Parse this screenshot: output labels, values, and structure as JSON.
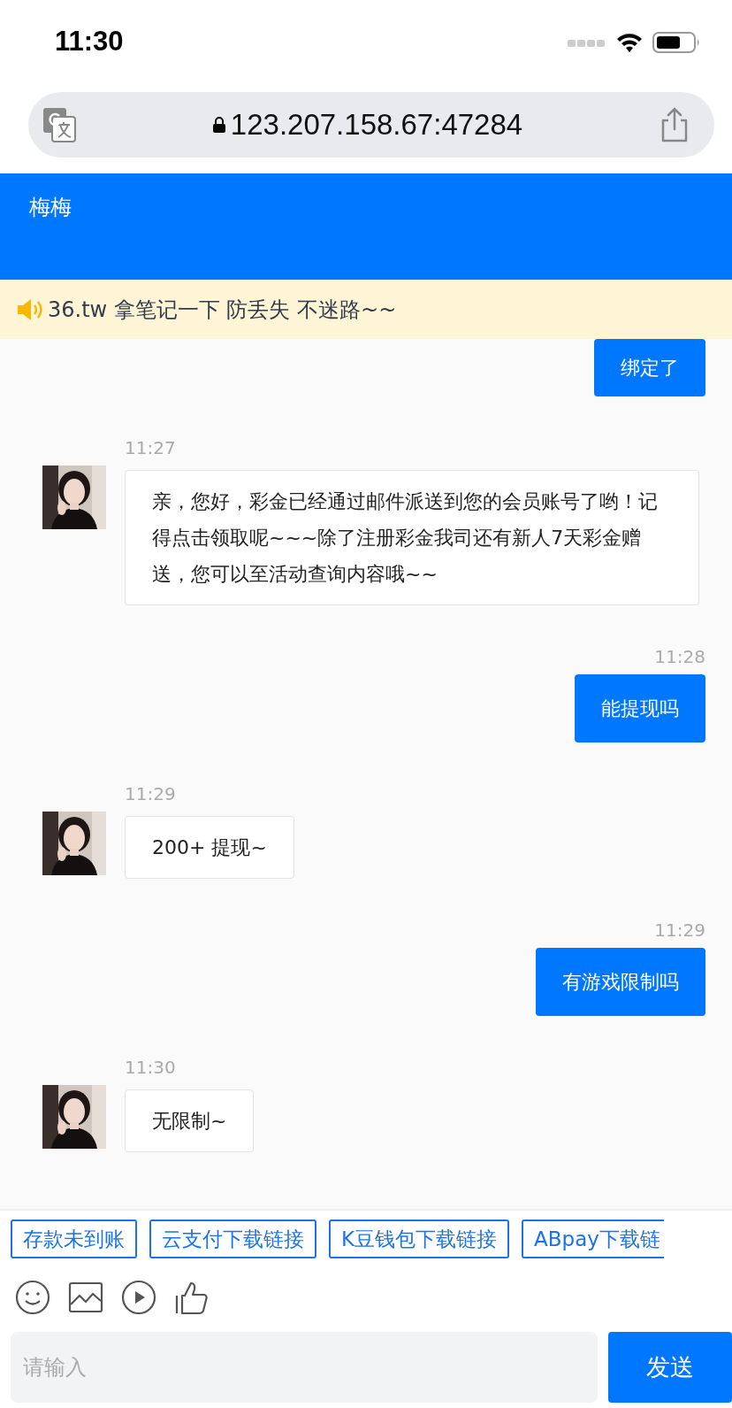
{
  "status_bar": {
    "time": "11:30"
  },
  "browser": {
    "url": "123.207.158.67:47284"
  },
  "header": {
    "title": "梅梅"
  },
  "notice": {
    "text": "36.tw 拿笔记一下 防丢失 不迷路~~"
  },
  "messages": [
    {
      "kind": "self",
      "text": "绑定了"
    },
    {
      "kind": "other",
      "time": "11:27",
      "text": "亲，您好，彩金已经通过邮件派送到您的会员账号了哟！记得点击领取呢~~~除了注册彩金我司还有新人7天彩金赠送，您可以至活动查询内容哦~~"
    },
    {
      "kind": "self",
      "time": "11:28",
      "text": "能提现吗"
    },
    {
      "kind": "other",
      "time": "11:29",
      "text": "200+ 提现~"
    },
    {
      "kind": "self",
      "time": "11:29",
      "text": "有游戏限制吗"
    },
    {
      "kind": "other",
      "time": "11:30",
      "text": "无限制~"
    }
  ],
  "quick_replies": [
    "存款未到账",
    "云支付下载链接",
    "K豆钱包下载链接",
    "ABpay下载链"
  ],
  "composer": {
    "placeholder": "请输入",
    "send": "发送"
  }
}
